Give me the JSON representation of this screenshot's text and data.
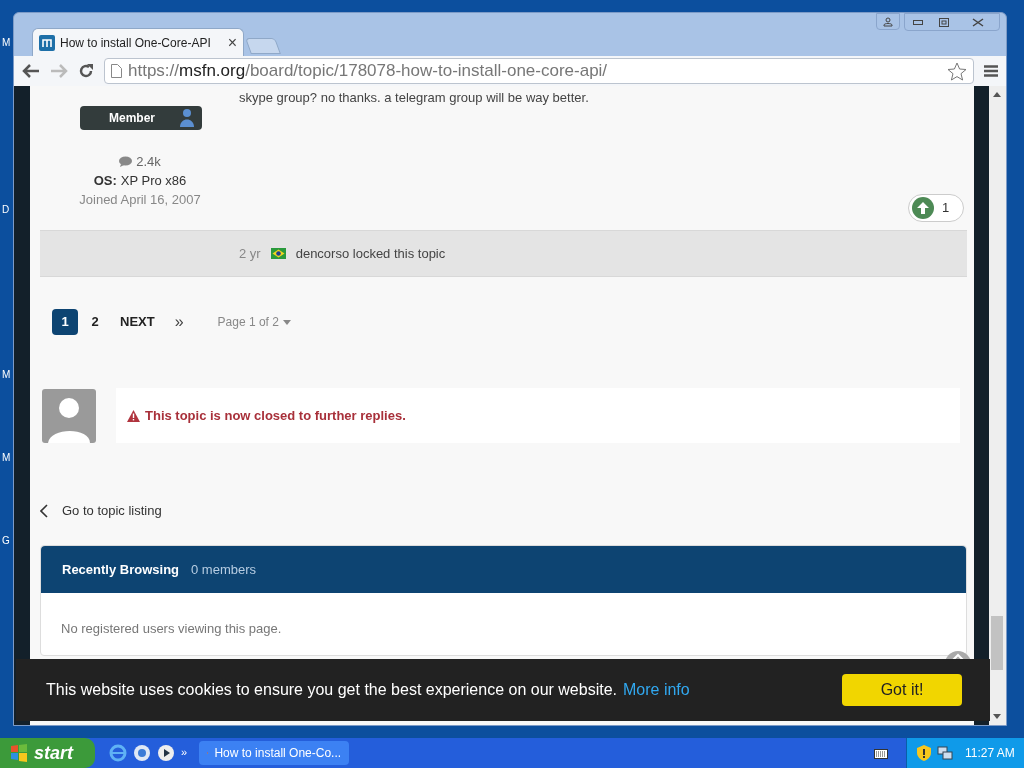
{
  "desktop_labels": [
    {
      "text": "M"
    },
    {
      "text": "D"
    },
    {
      "text": "M"
    },
    {
      "text": "M"
    },
    {
      "text": "G"
    }
  ],
  "browser": {
    "tabs": [
      {
        "title": "How to install One-Core-API",
        "selected": true,
        "close": "×"
      }
    ],
    "url": {
      "scheme": "https://",
      "host": "msfn.org",
      "path": "/board/topic/178078-how-to-install-one-core-api/"
    }
  },
  "post": {
    "text": "skype group? no thanks. a telegram group will be way better.",
    "rank": "Member",
    "posts": "2.4k",
    "os_label": "OS:",
    "os_value": "XP Pro x86",
    "joined": "Joined April 16, 2007",
    "reputation": "1"
  },
  "event": {
    "time": "2 yr",
    "text": "dencorso locked this topic"
  },
  "pagination": {
    "pages": [
      {
        "label": "1",
        "selected": true
      },
      {
        "label": "2",
        "selected": false
      }
    ],
    "next": "NEXT",
    "last": "»",
    "page_jump": "Page 1 of 2"
  },
  "closed_notice": "This topic is now closed to further replies.",
  "back_link": "Go to topic listing",
  "recently_browsing": {
    "title": "Recently Browsing",
    "count": "0 members",
    "empty": "No registered users viewing this page."
  },
  "cookie_bar": {
    "text": "This website uses cookies to ensure you get the best experience on our website.",
    "link": "More info",
    "button": "Got it!"
  },
  "taskbar": {
    "start": "start",
    "windows": [
      {
        "title": "How to install One-Co...",
        "selected": false
      }
    ],
    "chevron": "»",
    "clock": "11:27 AM"
  }
}
